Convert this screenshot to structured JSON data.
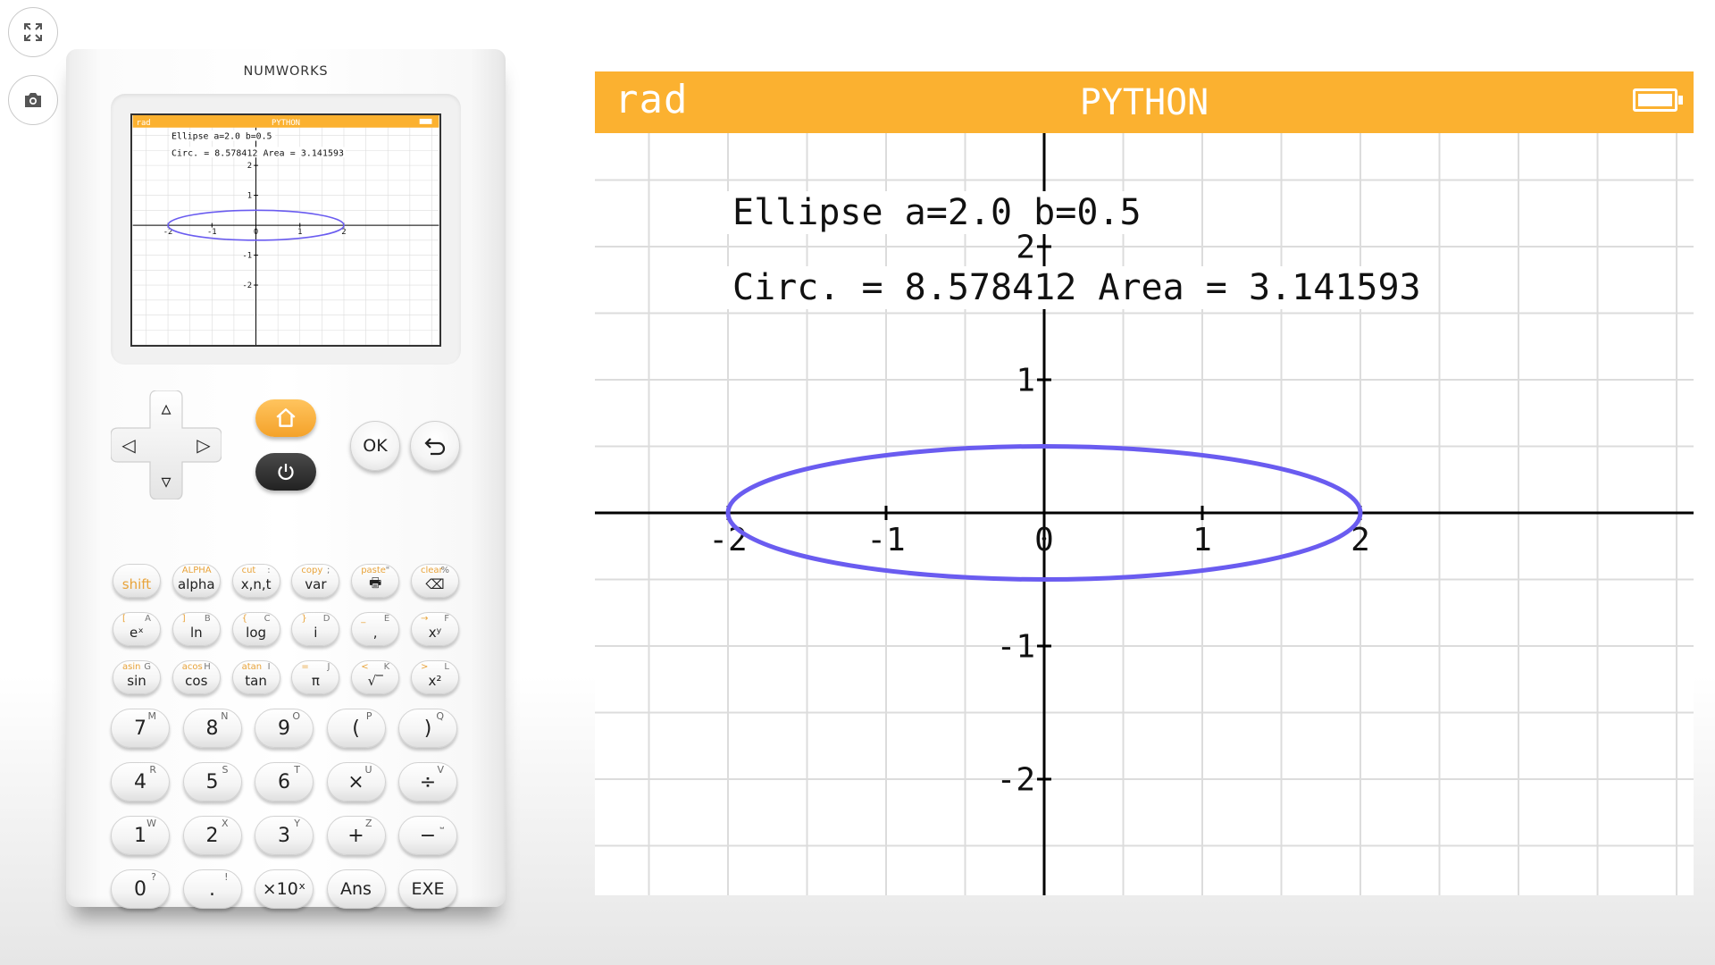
{
  "sidebar": {
    "fullscreen_icon": "fullscreen-icon",
    "screenshot_icon": "camera-icon"
  },
  "calculator": {
    "brand": "NUMWORKS",
    "home_icon": "home-icon",
    "power_icon": "power-icon",
    "ok_label": "OK",
    "back_icon": "back-icon",
    "dpad": {
      "up": "▵",
      "down": "▿",
      "left": "◁",
      "right": "▷"
    },
    "function_rows": [
      [
        {
          "main": "shift",
          "tl": "",
          "tr": ""
        },
        {
          "main": "alpha",
          "tl": "ALPHA",
          "tr": ""
        },
        {
          "main": "x,n,t",
          "tl": "cut",
          "tr": ":"
        },
        {
          "main": "var",
          "tl": "copy",
          "tr": ";"
        },
        {
          "main": "🖶",
          "tl": "paste",
          "tr": "\""
        },
        {
          "main": "⌫",
          "tl": "clear",
          "tr": "%"
        }
      ],
      [
        {
          "main": "eˣ",
          "tl": "[",
          "tr": "A"
        },
        {
          "main": "ln",
          "tl": "]",
          "tr": "B"
        },
        {
          "main": "log",
          "tl": "{",
          "tr": "C"
        },
        {
          "main": "i",
          "tl": "}",
          "tr": "D"
        },
        {
          "main": ",",
          "tl": "_",
          "tr": "E"
        },
        {
          "main": "xʸ",
          "tl": "→",
          "tr": "F"
        }
      ],
      [
        {
          "main": "sin",
          "tl": "asin",
          "tr": "G"
        },
        {
          "main": "cos",
          "tl": "acos",
          "tr": "H"
        },
        {
          "main": "tan",
          "tl": "atan",
          "tr": "I"
        },
        {
          "main": "π",
          "tl": "=",
          "tr": "J"
        },
        {
          "main": "√‾",
          "tl": "<",
          "tr": "K"
        },
        {
          "main": "x²",
          "tl": ">",
          "tr": "L"
        }
      ]
    ],
    "number_rows": [
      [
        {
          "main": "7",
          "tr": "M"
        },
        {
          "main": "8",
          "tr": "N"
        },
        {
          "main": "9",
          "tr": "O"
        },
        {
          "main": "(",
          "tr": "P"
        },
        {
          "main": ")",
          "tr": "Q"
        }
      ],
      [
        {
          "main": "4",
          "tr": "R"
        },
        {
          "main": "5",
          "tr": "S"
        },
        {
          "main": "6",
          "tr": "T"
        },
        {
          "main": "×",
          "tr": "U"
        },
        {
          "main": "÷",
          "tr": "V"
        }
      ],
      [
        {
          "main": "1",
          "tr": "W"
        },
        {
          "main": "2",
          "tr": "X"
        },
        {
          "main": "3",
          "tr": "Y"
        },
        {
          "main": "+",
          "tr": "Z"
        },
        {
          "main": "−",
          "tr": "⎵"
        }
      ],
      [
        {
          "main": "0",
          "tr": "?"
        },
        {
          "main": ".",
          "tr": "!"
        },
        {
          "main": "×10ˣ",
          "tr": ""
        },
        {
          "main": "Ans",
          "tr": ""
        },
        {
          "main": "EXE",
          "tr": ""
        }
      ]
    ]
  },
  "screen": {
    "angle_mode": "rad",
    "app_title": "PYTHON",
    "battery_icon": "battery-icon",
    "output_line_1": "Ellipse a=2.0 b=0.5",
    "output_line_2": "Circ. = 8.578412 Area = 3.141593",
    "colors": {
      "titlebar": "#fbb130",
      "curve": "#6a5cf0",
      "grid": "#dcdcdc",
      "axis": "#000000"
    }
  },
  "chart_data": {
    "type": "line",
    "series": [
      {
        "shape": "ellipse",
        "center": [
          0,
          0
        ],
        "a": 2.0,
        "b": 0.5
      }
    ],
    "xlim": [
      -2,
      2
    ],
    "ylim": [
      -2,
      2
    ],
    "x_ticks": [
      "-2",
      "-1",
      "0",
      "1",
      "2"
    ],
    "y_ticks": [
      "2",
      "1",
      "-1",
      "-2"
    ],
    "grid": true
  }
}
